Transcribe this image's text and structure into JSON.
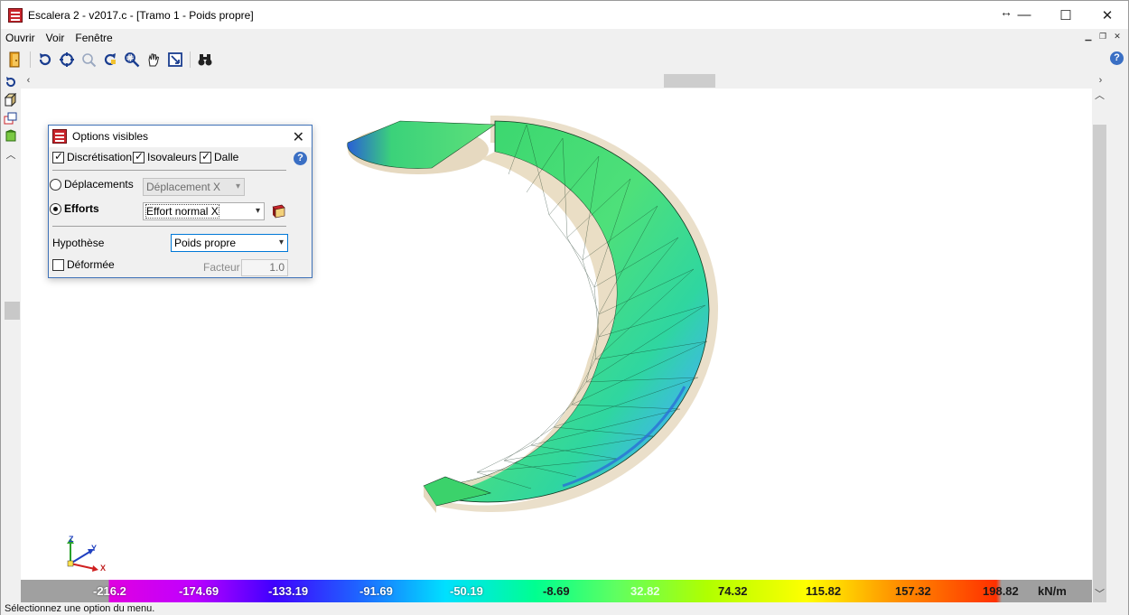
{
  "window": {
    "title": "Escalera 2 - v2017.c - [Tramo 1 - Poids propre]",
    "minimize_glyph": "—",
    "maximize_glyph": "☐",
    "close_glyph": "✕",
    "resize_glyph": "↔"
  },
  "menu": {
    "items": [
      "Ouvrir",
      "Voir",
      "Fenêtre"
    ]
  },
  "toolbar": {
    "icons": [
      "open-door-icon",
      "rotate-icon",
      "zoom-extents-icon",
      "zoom-previous-icon",
      "redraw-icon",
      "zoom-window-icon",
      "pan-hand-icon",
      "fit-view-icon",
      "binoculars-icon"
    ]
  },
  "dialog": {
    "title": "Options visibles",
    "close_glyph": "✕",
    "checkboxes": [
      {
        "label": "Discrétisation",
        "checked": true
      },
      {
        "label": "Isovaleurs",
        "checked": true
      },
      {
        "label": "Dalle",
        "checked": true
      }
    ],
    "deplacements": {
      "label": "Déplacements",
      "selected": false,
      "select_value": "Déplacement X"
    },
    "efforts": {
      "label": "Efforts",
      "selected": true,
      "select_value": "Effort normal X"
    },
    "hypothese": {
      "label": "Hypothèse",
      "select_value": "Poids propre"
    },
    "deformee": {
      "label": "Déformée",
      "checked": false
    },
    "facteur": {
      "label": "Facteur",
      "value": "1.0"
    },
    "help_glyph": "?"
  },
  "legend": {
    "unit": "kN/m",
    "values": [
      "-216.2",
      "-174.69",
      "-133.19",
      "-91.69",
      "-50.19",
      "-8.69",
      "32.82",
      "74.32",
      "115.82",
      "157.32",
      "198.82"
    ]
  },
  "axes": {
    "x": "X",
    "y": "Y",
    "z": "Z"
  },
  "status": {
    "text": "Sélectionnez une option du menu."
  },
  "colors": {
    "accent": "#3f72b8",
    "mesh_green": "#3bd26b",
    "mesh_blue": "#2a6fd6",
    "slab_beige": "#e6d9c0"
  }
}
